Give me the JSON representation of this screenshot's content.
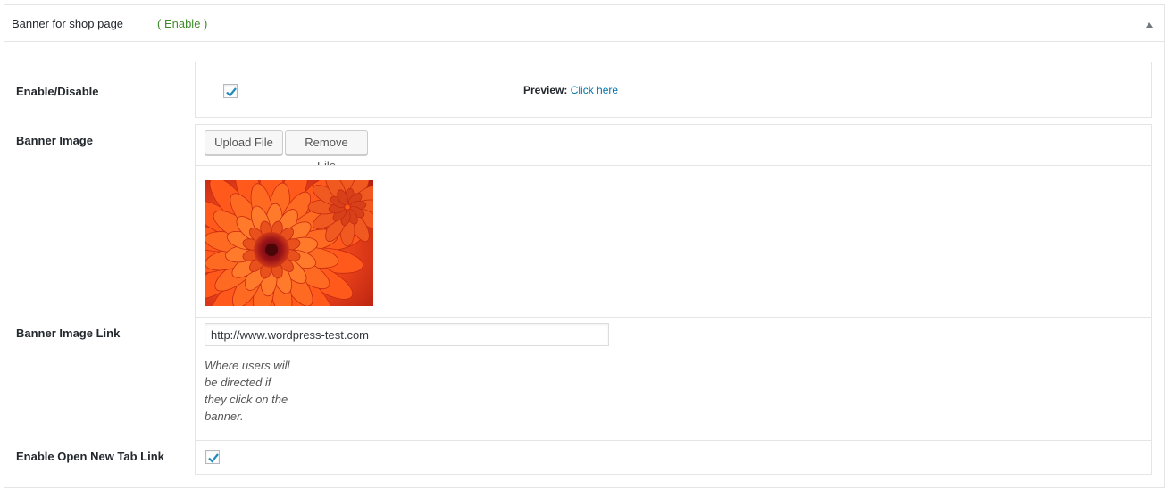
{
  "panel": {
    "title": "Banner for shop page",
    "status": "( Enable )",
    "status_color": "#3f8a2a",
    "toggle_icon": "triangle-up-icon"
  },
  "fields": {
    "enable": {
      "label": "Enable/Disable",
      "checked": true,
      "preview_label": "Preview:",
      "preview_link": "Click here"
    },
    "banner_image": {
      "label": "Banner Image",
      "upload_button": "Upload File",
      "remove_button": "Remove File",
      "image": "orange-dahlia-flower-photo"
    },
    "banner_link": {
      "label": "Banner Image Link",
      "value": "http://www.wordpress-test.com",
      "description_lines": [
        "Where users will",
        "be directed if",
        "they click on the",
        "banner."
      ]
    },
    "new_tab": {
      "label": "Enable Open New Tab Link",
      "checked": true
    }
  },
  "colors": {
    "link": "#0073aa",
    "check": "#1e8cbe"
  }
}
